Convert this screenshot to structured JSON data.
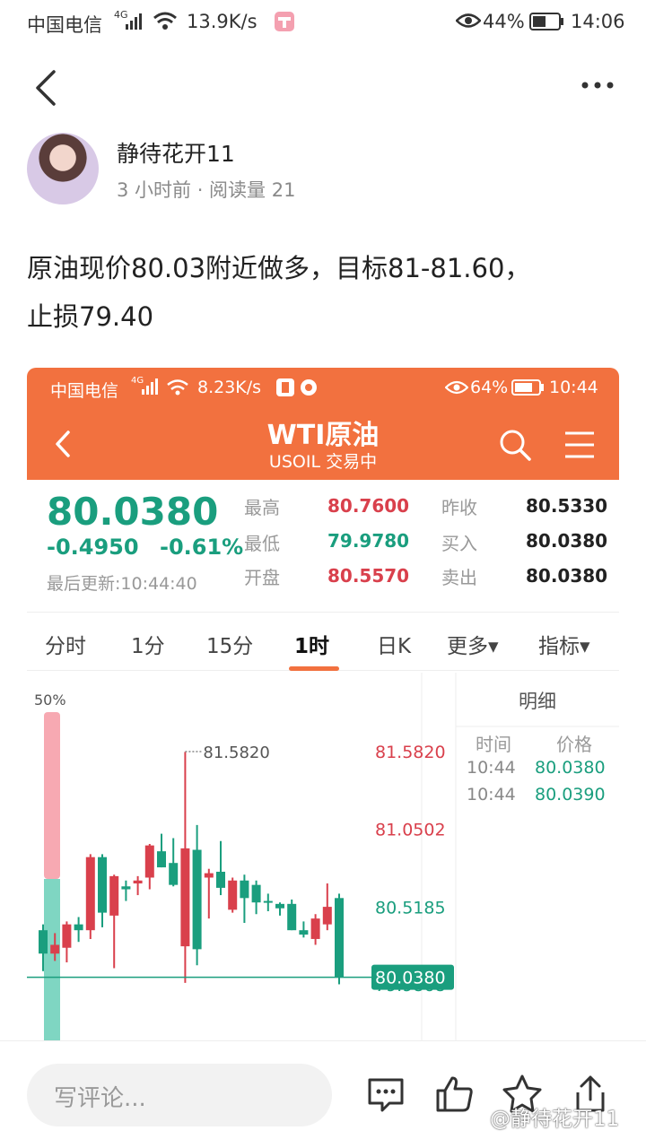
{
  "status_bar": {
    "carrier": "中国电信",
    "network": "4G",
    "speed": "13.9K/s",
    "battery": "44%",
    "time": "14:06"
  },
  "author": {
    "name": "静待花开11",
    "meta": "3 小时前 · 阅读量 21"
  },
  "post": {
    "line1": "原油现价80.03附近做多，目标81-81.60，",
    "line2": "止损79.40"
  },
  "screenshot": {
    "status_bar": {
      "carrier": "中国电信",
      "network": "4G",
      "speed": "8.23K/s",
      "battery": "64%",
      "time": "10:44"
    },
    "title": "WTI原油",
    "subtitle": "USOIL 交易中",
    "quote": {
      "price": "80.0380",
      "change": "-0.4950",
      "change_pct": "-0.61%",
      "updated": "最后更新:10:44:40",
      "high_label": "最高",
      "high": "80.7600",
      "low_label": "最低",
      "low": "79.9780",
      "open_label": "开盘",
      "open": "80.5570",
      "prev_close_label": "昨收",
      "prev_close": "80.5330",
      "bid_label": "买入",
      "bid": "80.0380",
      "ask_label": "卖出",
      "ask": "80.0380"
    },
    "tabs": [
      "分时",
      "1分",
      "15分",
      "1时",
      "日K",
      "更多▾",
      "指标▾"
    ],
    "active_tab": "1时",
    "detail": {
      "title": "明细",
      "headers": [
        "时间",
        "价格"
      ],
      "rows": [
        {
          "time": "10:44",
          "price": "80.0380"
        },
        {
          "time": "10:44",
          "price": "80.0390"
        }
      ]
    },
    "chart_data": {
      "type": "candlestick",
      "volume_label": "50%",
      "max_marker": "81.5820",
      "y_labels": [
        "81.5820",
        "81.0502",
        "80.5185",
        "79.9868"
      ],
      "current_price": "80.0380",
      "colors": {
        "up": "#d9404c",
        "down": "#1a9e7e"
      }
    }
  },
  "bottom_bar": {
    "comment_placeholder": "写评论...",
    "watermark": "@静待花开11"
  }
}
